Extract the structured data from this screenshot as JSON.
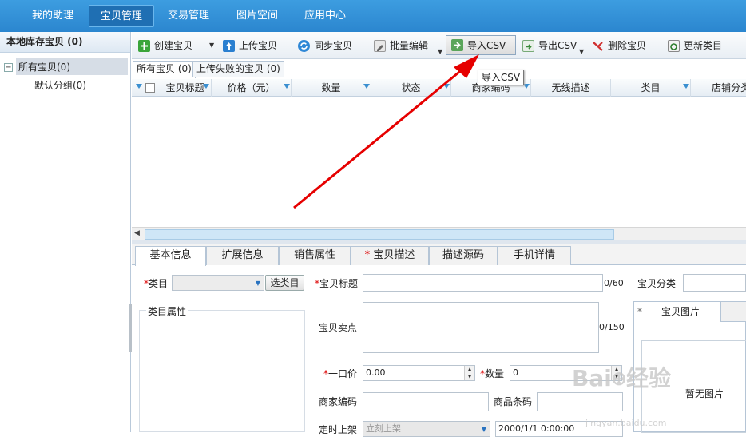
{
  "topnav": {
    "tabs": [
      "我的助理",
      "宝贝管理",
      "交易管理",
      "图片空间",
      "应用中心"
    ],
    "active": "宝贝管理"
  },
  "sidebar": {
    "title": "本地库存宝贝 (0)",
    "tree": [
      {
        "label": "所有宝贝(0)",
        "expanded": true
      },
      {
        "label": "默认分组(0)"
      }
    ]
  },
  "toolbar": {
    "create": "创建宝贝",
    "upload": "上传宝贝",
    "sync": "同步宝贝",
    "batch_edit": "批量编辑",
    "import_csv": "导入CSV",
    "export_csv": "导出CSV",
    "delete": "删除宝贝",
    "update_category": "更新类目"
  },
  "tooltip": "导入CSV",
  "list_tabs": [
    "所有宝贝 (0)",
    "上传失败的宝贝 (0)"
  ],
  "grid": {
    "columns": [
      "宝贝标题",
      "价格（元）",
      "数量",
      "状态",
      "商家编码",
      "无线描述",
      "类目",
      "店铺分类"
    ]
  },
  "panel_tabs": [
    "基本信息",
    "扩展信息",
    "销售属性",
    "宝贝描述",
    "描述源码",
    "手机详情"
  ],
  "form": {
    "category_label": "类目",
    "select_category_btn": "选类目",
    "title_label": "宝贝标题",
    "title_count": "0/60",
    "shop_category_label": "宝贝分类",
    "category_attrs_label": "类目属性",
    "selling_point_label": "宝贝卖点",
    "selling_point_count": "0/150",
    "price_label": "一口价",
    "price_value": "0.00",
    "quantity_label": "数量",
    "quantity_value": "0",
    "merchant_code_label": "商家编码",
    "barcode_label": "商品条码",
    "schedule_label": "定时上架",
    "schedule_value": "立刻上架",
    "schedule_time": "2000/1/1 0:00:00"
  },
  "pic_panel": {
    "tab": "宝贝图片",
    "empty_text": "暂无图片"
  },
  "watermark": {
    "brand": "Bai 经验",
    "url": "jingyan.baidu.com"
  },
  "colors": {
    "nav": "#2b86cf",
    "accent": "#3b8fd0",
    "arrow": "#e60000",
    "required": "#dd0000"
  }
}
